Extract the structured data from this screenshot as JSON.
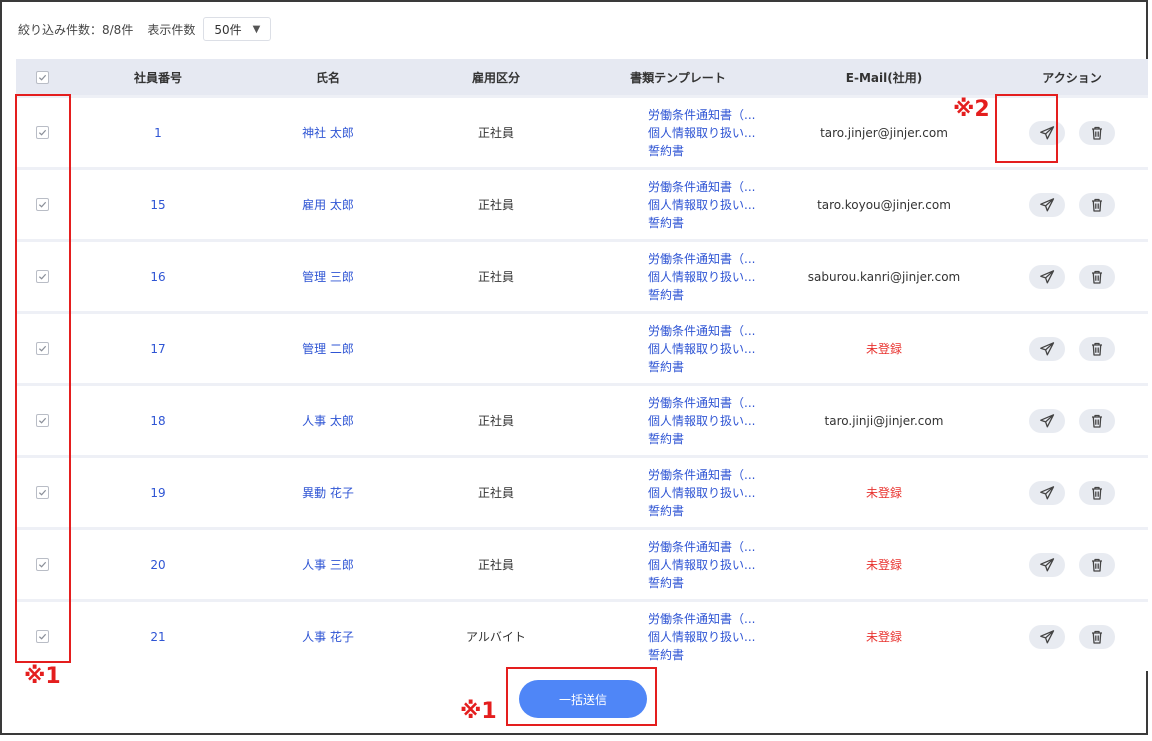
{
  "toolbar": {
    "filter_count": "絞り込み件数：8/8件",
    "per_page_label": "表示件数",
    "per_page_value": "50件"
  },
  "columns": {
    "id": "社員番号",
    "name": "氏名",
    "type": "雇用区分",
    "templates": "書類テンプレート",
    "email": "E-Mail(社用)",
    "action": "アクション"
  },
  "rows": [
    {
      "id": "1",
      "name": "神社 太郎",
      "type": "正社員",
      "templates": [
        "労働条件通知書（...",
        "個人情報取り扱い...",
        "誓約書"
      ],
      "email": "taro.jinjer@jinjer.com",
      "registered": true
    },
    {
      "id": "15",
      "name": "雇用 太郎",
      "type": "正社員",
      "templates": [
        "労働条件通知書（...",
        "個人情報取り扱い...",
        "誓約書"
      ],
      "email": "taro.koyou@jinjer.com",
      "registered": true
    },
    {
      "id": "16",
      "name": "管理 三郎",
      "type": "正社員",
      "templates": [
        "労働条件通知書（...",
        "個人情報取り扱い...",
        "誓約書"
      ],
      "email": "saburou.kanri@jinjer.com",
      "registered": true
    },
    {
      "id": "17",
      "name": "管理 二郎",
      "type": "",
      "templates": [
        "労働条件通知書（...",
        "個人情報取り扱い...",
        "誓約書"
      ],
      "email": "未登録",
      "registered": false
    },
    {
      "id": "18",
      "name": "人事 太郎",
      "type": "正社員",
      "templates": [
        "労働条件通知書（...",
        "個人情報取り扱い...",
        "誓約書"
      ],
      "email": "taro.jinji@jinjer.com",
      "registered": true
    },
    {
      "id": "19",
      "name": "異動 花子",
      "type": "正社員",
      "templates": [
        "労働条件通知書（...",
        "個人情報取り扱い...",
        "誓約書"
      ],
      "email": "未登録",
      "registered": false
    },
    {
      "id": "20",
      "name": "人事 三郎",
      "type": "正社員",
      "templates": [
        "労働条件通知書（...",
        "個人情報取り扱い...",
        "誓約書"
      ],
      "email": "未登録",
      "registered": false
    },
    {
      "id": "21",
      "name": "人事 花子",
      "type": "アルバイト",
      "templates": [
        "労働条件通知書（...",
        "個人情報取り扱い...",
        "誓約書"
      ],
      "email": "未登録",
      "registered": false
    }
  ],
  "bulk_send_label": "一括送信",
  "annotations": {
    "mark1_left": "※1",
    "mark1_button": "※1",
    "mark2": "※2"
  },
  "colors": {
    "link": "#2f55d4",
    "unregistered": "#e8322e",
    "primary_button": "#4f86f7",
    "annotation": "#e41e1e"
  },
  "icons": {
    "send": "paper-plane-icon",
    "delete": "trash-icon",
    "checkbox": "check-icon"
  }
}
